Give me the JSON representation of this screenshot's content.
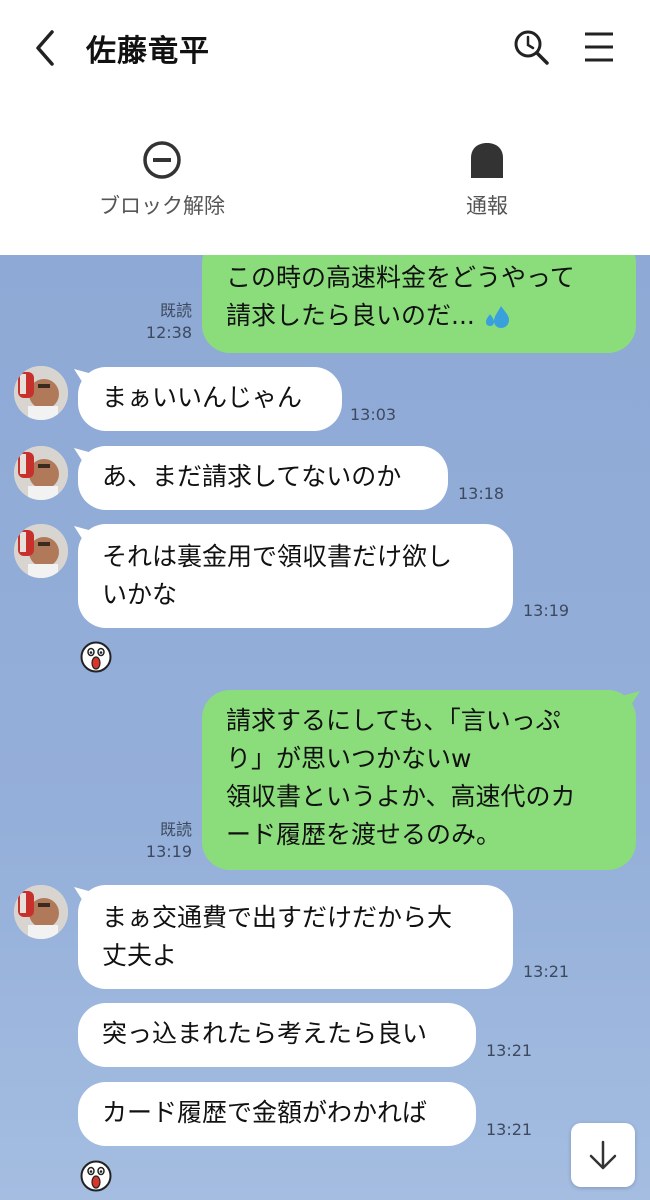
{
  "header": {
    "title": "佐藤竜平"
  },
  "actions": {
    "block_release": "ブロック解除",
    "report": "通報"
  },
  "messages": {
    "m1_line1": "この時の高速料金をどうやって",
    "m1_line2": "請求したら良いのだ...",
    "m1_read": "既読",
    "m1_time": "12:38",
    "m2_text": "まぁいいんじゃん",
    "m2_time": "13:03",
    "m3_text": "あ、まだ請求してないのか",
    "m3_time": "13:18",
    "m4_line1": "それは裏金用で領収書だけ欲し",
    "m4_line2": "いかな",
    "m4_time": "13:19",
    "m5_line1": "請求するにしても、「言いっぷ",
    "m5_line2": "り」が思いつかないw",
    "m5_line3": "領収書というよか、高速代のカ",
    "m5_line4": "ード履歴を渡せるのみ。",
    "m5_read": "既読",
    "m5_time": "13:19",
    "m6_line1": "まぁ交通費で出すだけだから大",
    "m6_line2": "丈夫よ",
    "m6_time": "13:21",
    "m7_text": "突っ込まれたら考えたら良い",
    "m7_time": "13:21",
    "m8_text": "カード履歴で金額がわかれば",
    "m8_time": "13:21"
  },
  "colors": {
    "chat_bg": "#8fa9d6",
    "outgoing_bubble": "#8bdd7b",
    "incoming_bubble": "#ffffff"
  },
  "icons": [
    "back-icon",
    "search-icon",
    "menu-icon",
    "block-icon",
    "report-icon",
    "sweat-drops-icon",
    "shocked-face-sticker",
    "scroll-down-icon"
  ]
}
